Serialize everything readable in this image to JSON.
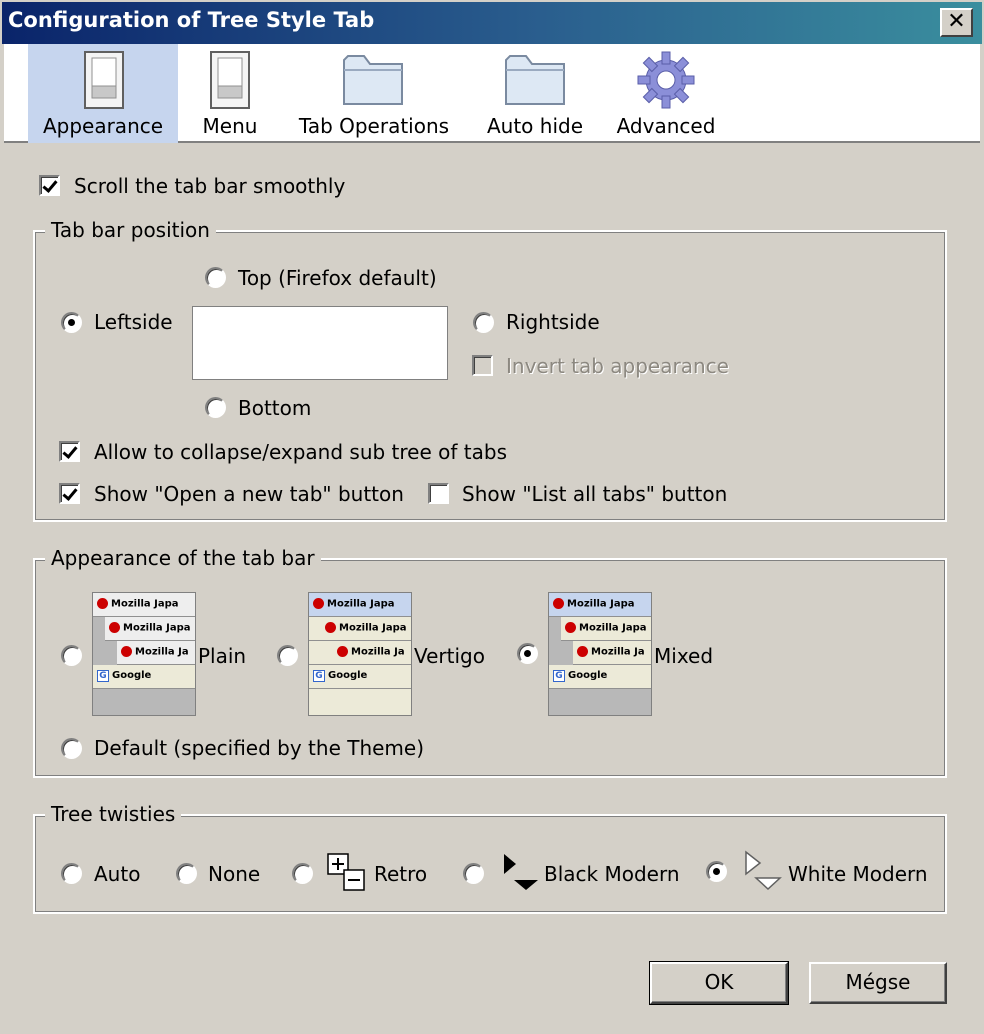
{
  "window": {
    "title": "Configuration of Tree Style Tab",
    "close_glyph": "✕"
  },
  "toolbar": {
    "tabs": [
      {
        "label": "Appearance",
        "icon": "switch-icon",
        "selected": true
      },
      {
        "label": "Menu",
        "icon": "switch-icon",
        "selected": false
      },
      {
        "label": "Tab Operations",
        "icon": "folder-icon",
        "selected": false
      },
      {
        "label": "Auto hide",
        "icon": "folder-icon",
        "selected": false
      },
      {
        "label": "Advanced",
        "icon": "gear-icon",
        "selected": false
      }
    ]
  },
  "scroll_smoothly": {
    "label": "Scroll the tab bar smoothly",
    "checked": true
  },
  "position": {
    "legend": "Tab bar position",
    "top": {
      "label": "Top (Firefox default)",
      "selected": false
    },
    "left": {
      "label": "Leftside",
      "selected": true
    },
    "right": {
      "label": "Rightside",
      "selected": false
    },
    "bottom": {
      "label": "Bottom",
      "selected": false
    },
    "invert": {
      "label": "Invert tab appearance",
      "checked": false,
      "disabled": true
    },
    "collapse": {
      "label": "Allow to collapse/expand sub tree of tabs",
      "checked": true
    },
    "newtab": {
      "label": "Show \"Open a new tab\" button",
      "checked": true
    },
    "listall": {
      "label": "Show \"List all tabs\" button",
      "checked": false
    }
  },
  "appearance": {
    "legend": "Appearance of the tab bar",
    "preview_rows": [
      "Mozilla Japa",
      "Mozilla Japa",
      "Mozilla Ja",
      "Google"
    ],
    "plain": {
      "label": "Plain",
      "selected": false
    },
    "vertigo": {
      "label": "Vertigo",
      "selected": false
    },
    "mixed": {
      "label": "Mixed",
      "selected": true
    },
    "default": {
      "label": "Default (specified by the Theme)",
      "selected": false
    }
  },
  "twisties": {
    "legend": "Tree twisties",
    "auto": {
      "label": "Auto",
      "selected": false
    },
    "none": {
      "label": "None",
      "selected": false
    },
    "retro": {
      "label": "Retro",
      "selected": false
    },
    "black": {
      "label": "Black Modern",
      "selected": false
    },
    "white": {
      "label": "White Modern",
      "selected": true
    }
  },
  "buttons": {
    "ok": "OK",
    "cancel": "Mégse"
  },
  "colors": {
    "title_start": "#0a246a",
    "title_end": "#3a8e9e",
    "selected_tab": "#c6d5ee",
    "dialog_bg": "#d4d0c8"
  }
}
